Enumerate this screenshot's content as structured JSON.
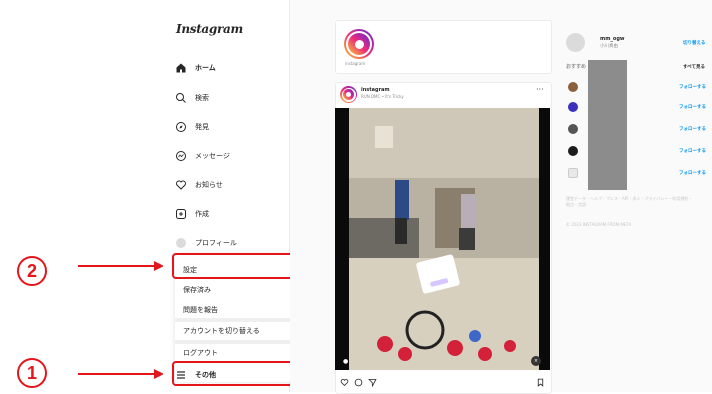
{
  "sidebar": {
    "logo": "Instagram",
    "items": [
      {
        "label": "ホーム",
        "icon": "home-icon"
      },
      {
        "label": "検索",
        "icon": "search-icon"
      },
      {
        "label": "発見",
        "icon": "compass-icon"
      },
      {
        "label": "メッセージ",
        "icon": "messenger-icon"
      },
      {
        "label": "お知らせ",
        "icon": "heart-icon"
      },
      {
        "label": "作成",
        "icon": "plus-square-icon"
      },
      {
        "label": "プロフィール",
        "icon": "avatar-icon"
      }
    ],
    "more_label": "その他"
  },
  "settings_menu": {
    "items": [
      {
        "label": "設定",
        "icon": "gear-icon"
      },
      {
        "label": "保存済み",
        "icon": "bookmark-icon"
      },
      {
        "label": "問題を報告",
        "icon": "report-icon"
      },
      {
        "label": "アカウントを切り替える"
      },
      {
        "label": "ログアウト"
      }
    ]
  },
  "callouts": {
    "step1": "1",
    "step2": "2"
  },
  "story": {
    "name": "instagram"
  },
  "post": {
    "username": "instagram",
    "caption": "RUN DMC • It's Tricky"
  },
  "profile": {
    "username": "mm_ogw",
    "name": "小川真由",
    "switch": "切り替える"
  },
  "suggestions": {
    "title": "おすすめ",
    "see_all": "すべて見る",
    "follow_label": "フォローする",
    "count": 5
  },
  "footer": {
    "links": "運営データ・ヘルプ・プレス・API・求人・プライバシー・利用規約・拠点・言語",
    "copyright": "© 2023 INSTAGRAM FROM META"
  },
  "colors": {
    "accent": "#0095f6",
    "callout_red": "#e4161b"
  }
}
